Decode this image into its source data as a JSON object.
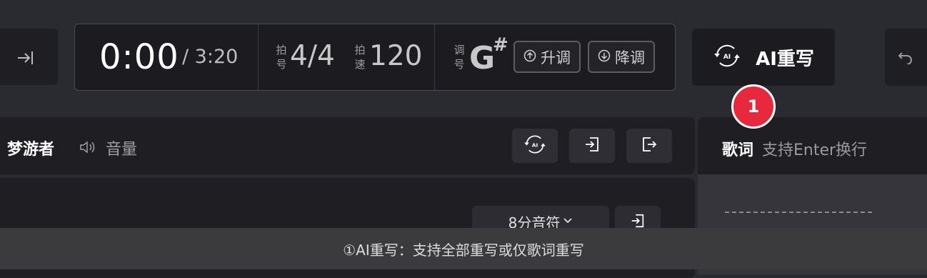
{
  "transport": {
    "time_current": "0:00",
    "time_total": "/ 3:20",
    "meter_label": [
      "拍",
      "号"
    ],
    "meter": "4/4",
    "tempo_label": [
      "拍",
      "速"
    ],
    "tempo": "120",
    "key_label": [
      "调",
      "号"
    ],
    "key": "G",
    "key_sharp": "#",
    "key_up": "升调",
    "key_down": "降调"
  },
  "toolbar": {
    "ai_rewrite": "AI重写",
    "ai_icon_text": "AI"
  },
  "track": {
    "name": "梦游者",
    "volume_label": "音量"
  },
  "content": {
    "note_value": "8分音符"
  },
  "lyrics": {
    "title": "歌词",
    "hint": "支持Enter换行"
  },
  "step": {
    "number": "1"
  },
  "caption": "①AI重写：支持全部重写或仅歌词重写",
  "colors": {
    "badge": "#e8283c",
    "background": "#2a2a31",
    "panel": "#1e1e23"
  }
}
